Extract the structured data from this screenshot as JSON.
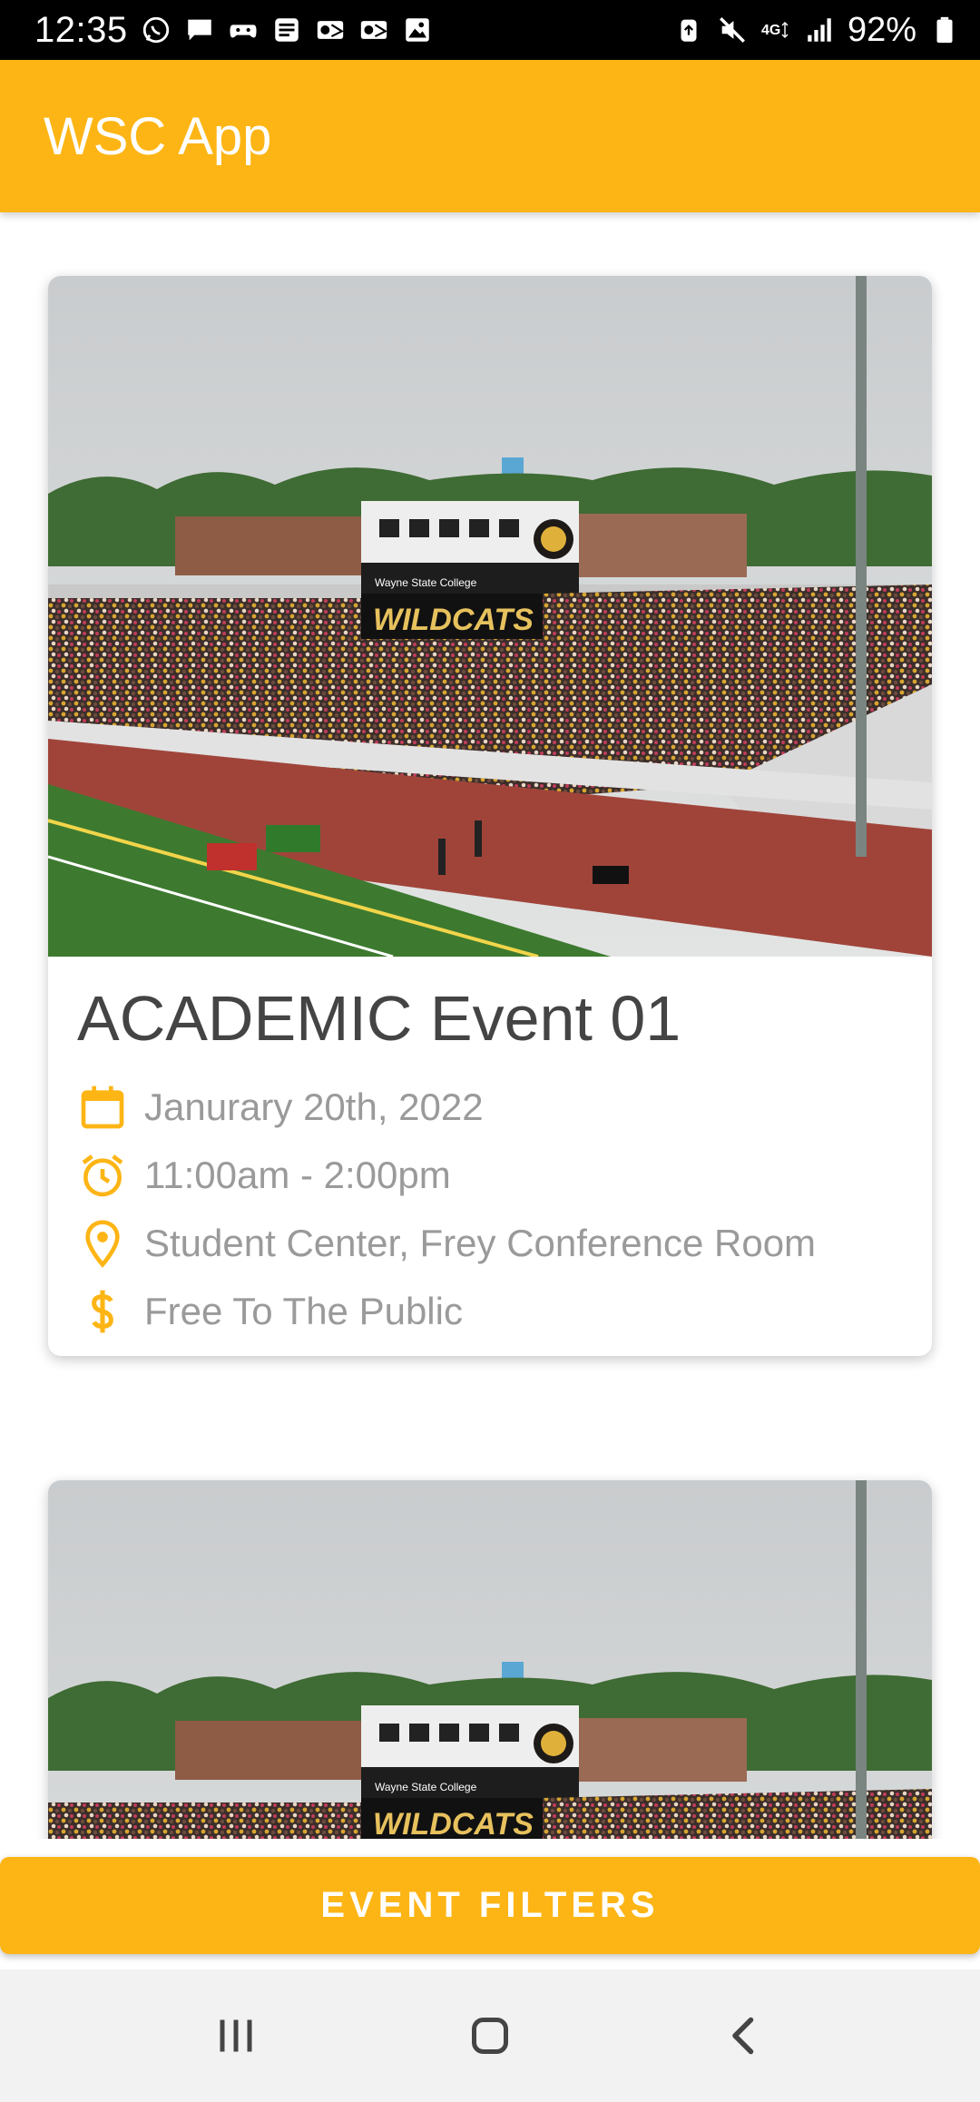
{
  "status_bar": {
    "time": "12:35",
    "battery_percent": "92%",
    "network": "4G",
    "left_icons": [
      "whatsapp-icon",
      "message-icon",
      "gamepad-icon",
      "call-filter-icon",
      "outlook-icon",
      "outlook-icon",
      "gallery-icon"
    ],
    "right_icons": [
      "recycle-icon",
      "mute-icon",
      "4g-icon",
      "signal-icon",
      "battery-icon"
    ]
  },
  "app_bar": {
    "title": "WSC App",
    "color": "#FDB515"
  },
  "events": [
    {
      "title": "ACADEMIC Event 01",
      "date": "Janurary 20th, 2022",
      "time": "11:00am - 2:00pm",
      "location": "Student Center, Frey Conference Room",
      "cost": "Free To The Public",
      "image_text": "WILDCATS",
      "image_subtext": "Wayne State College"
    },
    {
      "image_text": "WILDCATS",
      "image_subtext": "Wayne State College"
    }
  ],
  "filters_button": {
    "label": "EVENT FILTERS"
  },
  "accent_color": "#FDB515",
  "nav_bar": {
    "buttons": [
      "recent-apps-icon",
      "home-icon",
      "back-icon"
    ]
  }
}
